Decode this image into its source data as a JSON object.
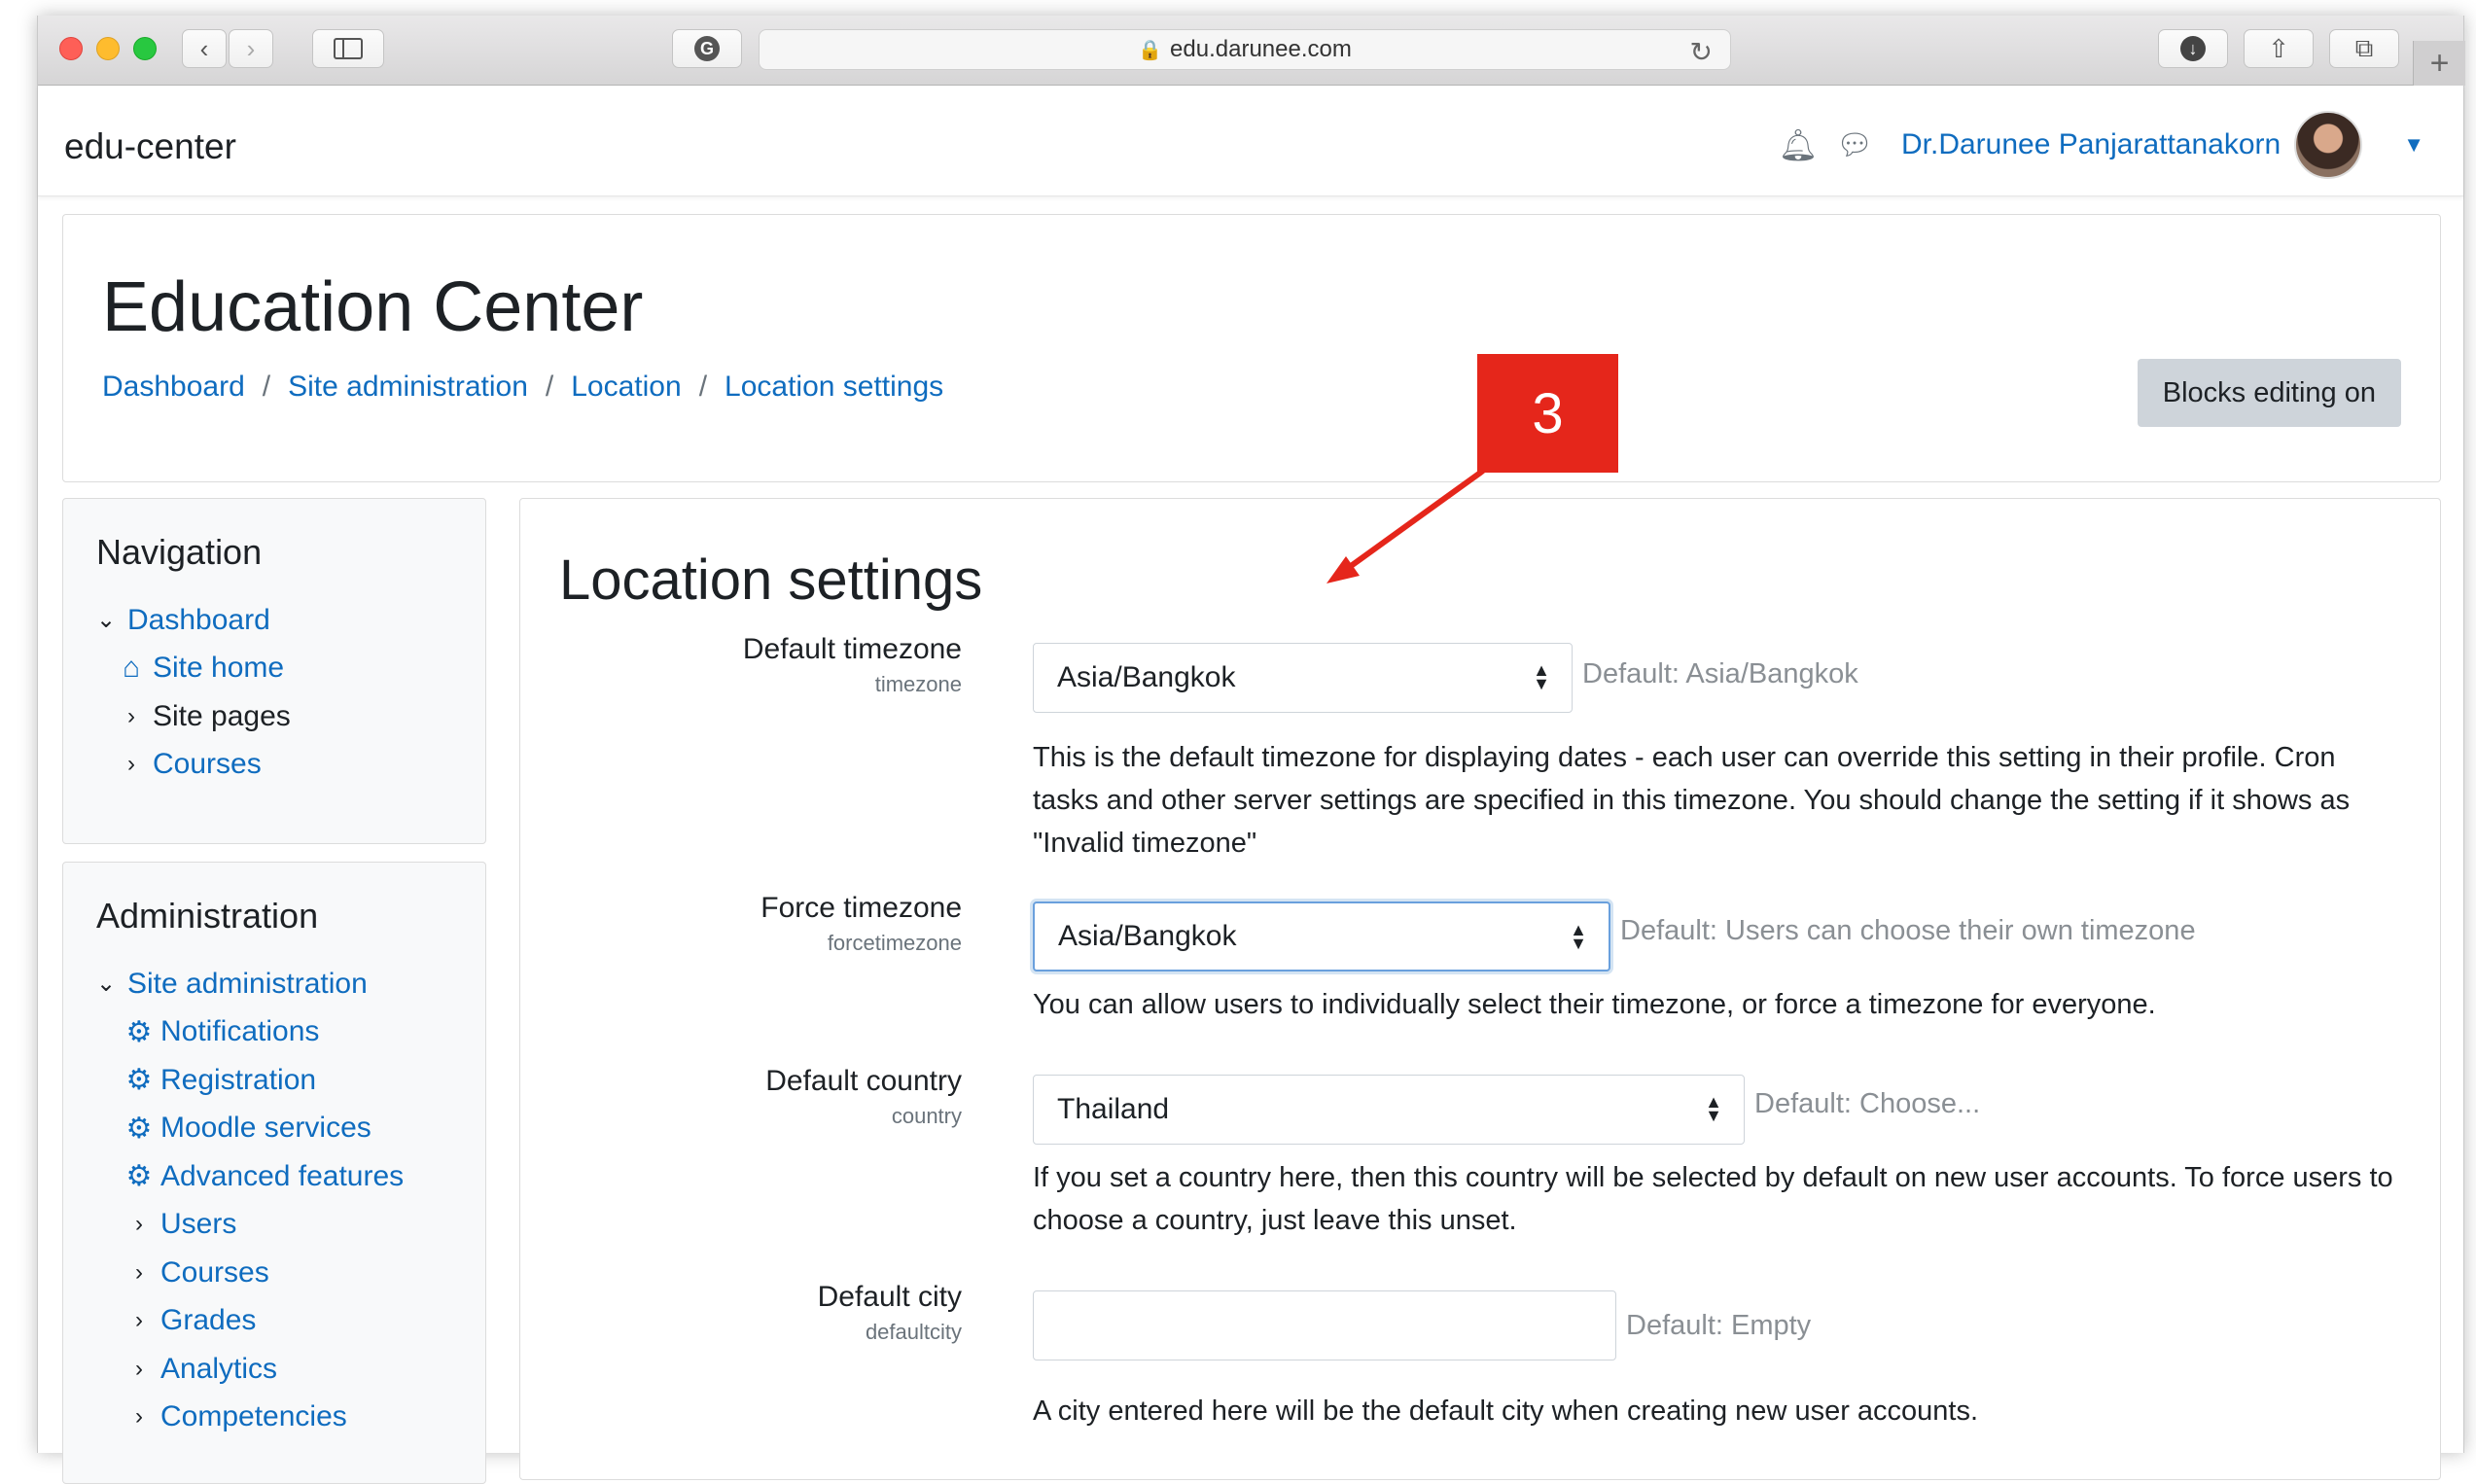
{
  "browser": {
    "url": "edu.darunee.com"
  },
  "navbar": {
    "brand": "edu-center",
    "username": "Dr.Darunee Panjarattanakorn"
  },
  "header": {
    "title": "Education Center",
    "breadcrumbs": [
      "Dashboard",
      "Site administration",
      "Location",
      "Location settings"
    ],
    "blocks_editing_label": "Blocks editing on"
  },
  "navigation_block": {
    "title": "Navigation",
    "items": [
      {
        "label": "Dashboard",
        "icon": "chevron-down-icon"
      },
      {
        "label": "Site home",
        "icon": "home-icon"
      },
      {
        "label": "Site pages",
        "icon": "chevron-right-icon"
      },
      {
        "label": "Courses",
        "icon": "chevron-right-icon"
      }
    ]
  },
  "administration_block": {
    "title": "Administration",
    "items": [
      {
        "label": "Site administration",
        "icon": "chevron-down-icon"
      },
      {
        "label": "Notifications",
        "icon": "gear-icon"
      },
      {
        "label": "Registration",
        "icon": "gear-icon"
      },
      {
        "label": "Moodle services",
        "icon": "gear-icon"
      },
      {
        "label": "Advanced features",
        "icon": "gear-icon"
      },
      {
        "label": "Users",
        "icon": "chevron-right-icon"
      },
      {
        "label": "Courses",
        "icon": "chevron-right-icon"
      },
      {
        "label": "Grades",
        "icon": "chevron-right-icon"
      },
      {
        "label": "Analytics",
        "icon": "chevron-right-icon"
      },
      {
        "label": "Competencies",
        "icon": "chevron-right-icon"
      }
    ]
  },
  "main": {
    "title": "Location settings",
    "settings": [
      {
        "label": "Default timezone",
        "key": "timezone",
        "value": "Asia/Bangkok",
        "default": "Default: Asia/Bangkok",
        "description": "This is the default timezone for displaying dates - each user can override this setting in their profile. Cron tasks and other server settings are specified in this timezone. You should change the setting if it shows as \"Invalid timezone\""
      },
      {
        "label": "Force timezone",
        "key": "forcetimezone",
        "value": "Asia/Bangkok",
        "default": "Default: Users can choose their own timezone",
        "description": "You can allow users to individually select their timezone, or force a timezone for everyone."
      },
      {
        "label": "Default country",
        "key": "country",
        "value": "Thailand",
        "default": "Default: Choose...",
        "description": "If you set a country here, then this country will be selected by default on new user accounts. To force users to choose a country, just leave this unset."
      },
      {
        "label": "Default city",
        "key": "defaultcity",
        "value": "",
        "default": "Default: Empty",
        "description": "A city entered here will be the default city when creating new user accounts."
      }
    ]
  },
  "annotation": {
    "number": "3",
    "color": "#e5261b"
  }
}
